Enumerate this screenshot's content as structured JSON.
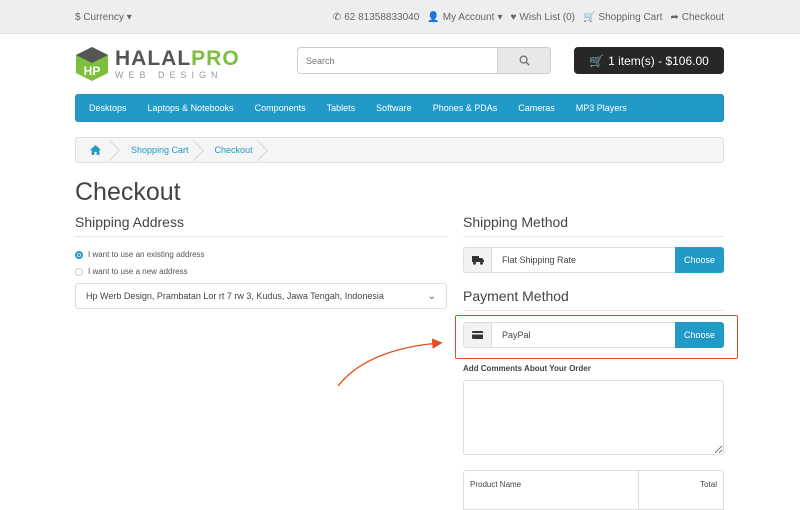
{
  "topbar": {
    "currency": "$ Currency",
    "phone": "62 81358833040",
    "my_account": "My Account",
    "wishlist": "Wish List (0)",
    "shopping_cart": "Shopping Cart",
    "checkout": "Checkout"
  },
  "logo": {
    "part1": "HALAL",
    "part2": "PRO",
    "tagline": "WEB DESIGN"
  },
  "search": {
    "placeholder": "Search"
  },
  "cart_button": {
    "label": "1 item(s) - $106.00"
  },
  "nav": {
    "items": [
      "Desktops",
      "Laptops & Notebooks",
      "Components",
      "Tablets",
      "Software",
      "Phones & PDAs",
      "Cameras",
      "MP3 Players"
    ]
  },
  "breadcrumb": {
    "items": [
      "Shopping Cart",
      "Checkout"
    ]
  },
  "page_title": "Checkout",
  "shipping_address": {
    "title": "Shipping Address",
    "option_existing": "I want to use an existing address",
    "option_new": "I want to use a new address",
    "selected_address": "Hp Werb Design, Prambatan Lor rt 7 rw 3, Kudus, Jawa Tengah, Indonesia"
  },
  "shipping_method": {
    "title": "Shipping Method",
    "value": "Flat Shipping Rate",
    "button": "Choose"
  },
  "payment_method": {
    "title": "Payment Method",
    "value": "PayPal",
    "button": "Choose"
  },
  "comments": {
    "label": "Add Comments About Your Order"
  },
  "product_table": {
    "headers": [
      "Product Name",
      "Total"
    ]
  },
  "colors": {
    "accent": "#229ac8",
    "highlight": "#e8491d",
    "cart_bg": "#272727",
    "logo_green": "#7bbf3d"
  }
}
